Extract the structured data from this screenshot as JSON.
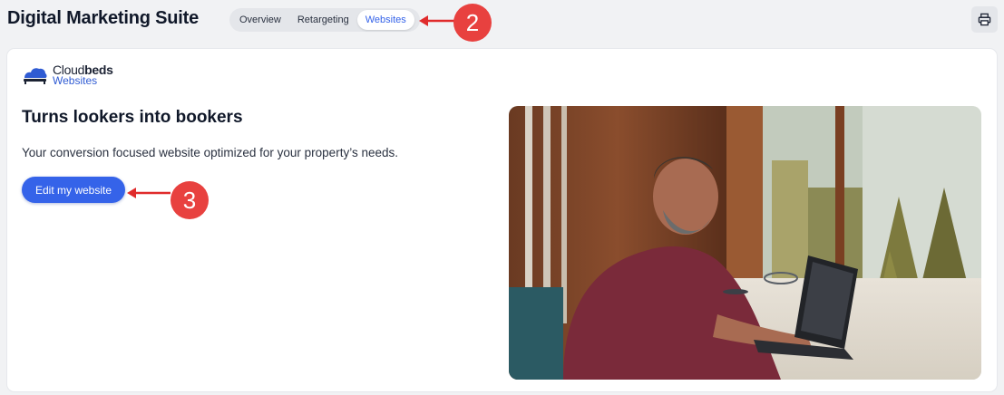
{
  "header": {
    "title": "Digital Marketing Suite",
    "tabs": [
      {
        "label": "Overview"
      },
      {
        "label": "Retargeting"
      },
      {
        "label": "Websites"
      }
    ],
    "active_tab": "Websites",
    "print_icon": "printer-icon"
  },
  "logo": {
    "brand_prefix": "Cloud",
    "brand_bold": "beds",
    "product": "Websites"
  },
  "content": {
    "headline": "Turns lookers into bookers",
    "description": "Your conversion focused website optimized for your property’s needs.",
    "cta_label": "Edit my website"
  },
  "annotations": [
    {
      "number": "2"
    },
    {
      "number": "3"
    }
  ],
  "colors": {
    "accent": "#3563e9",
    "annotation": "#e8413f",
    "background": "#f1f2f4"
  }
}
